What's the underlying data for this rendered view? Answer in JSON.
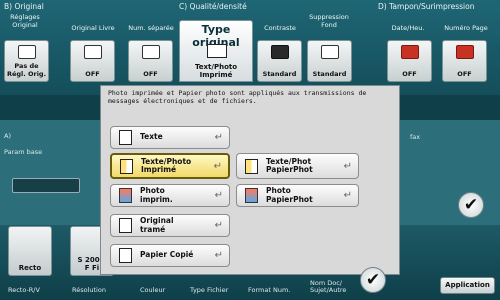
{
  "top": {
    "sections": [
      "B)  Original",
      "C)  Qualité/densité",
      "D)  Tampon/Surimpression"
    ],
    "columns": [
      {
        "label": "Réglages\nOriginal",
        "value": "Pas de\nRégl. Orig.",
        "icon": "document-icon"
      },
      {
        "label": "Original Livre",
        "value": "OFF",
        "icon": "book-icon"
      },
      {
        "label": "Num. séparée",
        "value": "OFF",
        "icon": "separate-scan-icon"
      },
      {
        "label": "Contraste",
        "value": "Standard",
        "icon": "contrast-icon"
      },
      {
        "label": "Suppression\nFond",
        "value": "Standard",
        "icon": "background-removal-icon"
      },
      {
        "label": "Date/Heu.",
        "value": "OFF",
        "icon": "date-time-icon"
      },
      {
        "label": "Numéro Page",
        "value": "OFF",
        "icon": "page-number-icon"
      }
    ],
    "selected": {
      "title": "Type original",
      "value": "Text/Photo\nImprimé"
    }
  },
  "middle": {
    "section_a": "A)",
    "param_base": "Param base",
    "fax": "fax"
  },
  "bottom": {
    "buttons": [
      {
        "value": "Recto",
        "label": "Recto-R/V"
      },
      {
        "value": "S 200 x\nF Fi",
        "label": "Résolution"
      }
    ],
    "labels": [
      "Couleur",
      "Type Fichier",
      "Format Num.",
      "Nom Doc/\nSujet/Autre"
    ]
  },
  "dialog": {
    "message": "Photo imprimée et Papier photo sont appliqués aux transmissions de messages électroniques et de fichiers.",
    "options_left": [
      {
        "label": "Texte"
      },
      {
        "label": "Texte/Photo\nImprimé",
        "selected": true
      },
      {
        "label": "Photo\nimprim."
      },
      {
        "label": "Original\ntramé"
      },
      {
        "label": "Papier Copié"
      }
    ],
    "options_right": [
      {
        "label": "Texte/Phot\nPapierPhot"
      },
      {
        "label": "Photo\nPapierPhot"
      }
    ],
    "return_symbol": "↵",
    "ok_symbol": "✔",
    "application": "Application"
  }
}
